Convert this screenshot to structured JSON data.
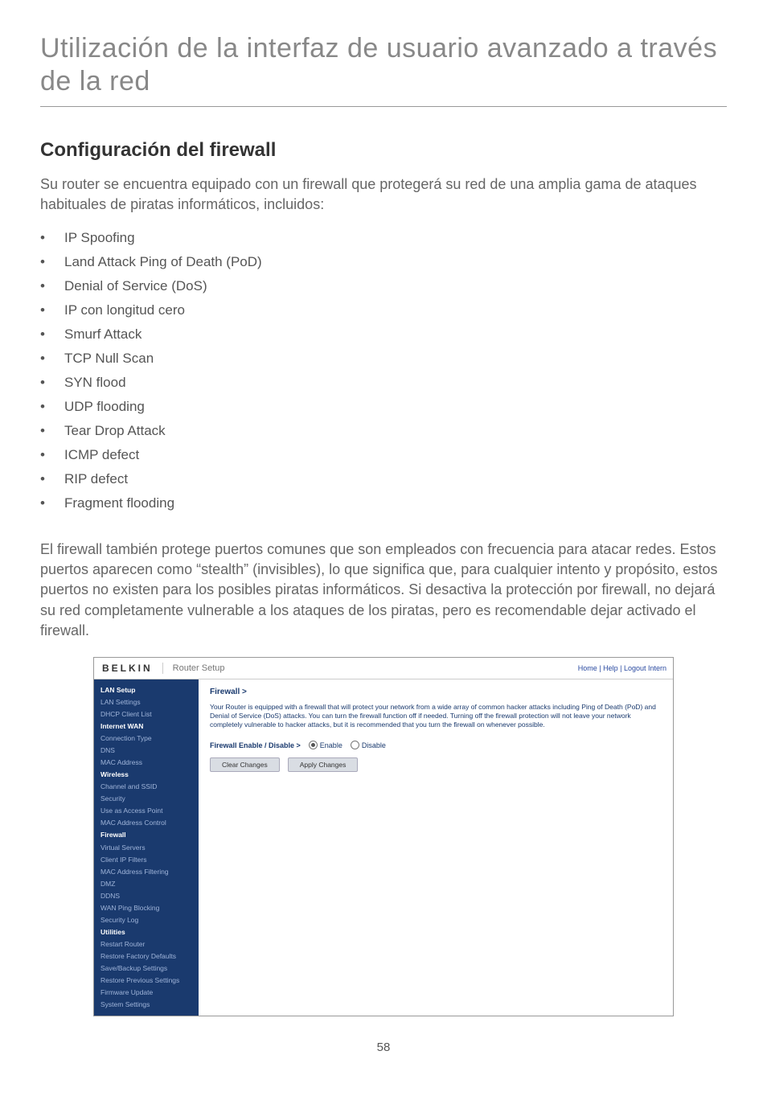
{
  "page_title": "Utilización de la interfaz de usuario avanzado a través de la red",
  "section_title": "Configuración del firewall",
  "intro": "Su router se encuentra equipado con un firewall que protegerá su red de una amplia gama de ataques habituales de piratas informáticos, incluidos:",
  "attacks": [
    "IP Spoofing",
    "Land Attack Ping of Death (PoD)",
    "Denial of Service (DoS)",
    "IP con longitud cero",
    "Smurf Attack",
    "TCP Null Scan",
    "SYN flood",
    "UDP flooding",
    "Tear Drop Attack",
    "ICMP defect",
    "RIP defect",
    "Fragment flooding"
  ],
  "description": "El firewall también protege puertos comunes que son empleados con frecuencia para atacar redes. Estos puertos aparecen como “stealth” (invisibles), lo que significa que, para cualquier intento y propósito, estos puertos no existen para los posibles piratas informáticos. Si desactiva la protección por firewall, no dejará su red completamente vulnerable a los ataques de los piratas, pero es recomendable dejar activado el firewall.",
  "page_number": "58",
  "screenshot": {
    "logo": "BELKIN",
    "header_label": "Router Setup",
    "top_links": "Home | Help | Logout   Intern",
    "sidebar": [
      {
        "label": "LAN Setup",
        "type": "section"
      },
      {
        "label": "LAN Settings",
        "type": "link"
      },
      {
        "label": "DHCP Client List",
        "type": "link"
      },
      {
        "label": "Internet WAN",
        "type": "section"
      },
      {
        "label": "Connection Type",
        "type": "link"
      },
      {
        "label": "DNS",
        "type": "link"
      },
      {
        "label": "MAC Address",
        "type": "link"
      },
      {
        "label": "Wireless",
        "type": "section"
      },
      {
        "label": "Channel and SSID",
        "type": "link"
      },
      {
        "label": "Security",
        "type": "link"
      },
      {
        "label": "Use as Access Point",
        "type": "link"
      },
      {
        "label": "MAC Address Control",
        "type": "link"
      },
      {
        "label": "Firewall",
        "type": "active"
      },
      {
        "label": "Virtual Servers",
        "type": "link"
      },
      {
        "label": "Client IP Filters",
        "type": "link"
      },
      {
        "label": "MAC Address Filtering",
        "type": "link"
      },
      {
        "label": "DMZ",
        "type": "link"
      },
      {
        "label": "DDNS",
        "type": "link"
      },
      {
        "label": "WAN Ping Blocking",
        "type": "link"
      },
      {
        "label": "Security Log",
        "type": "link"
      },
      {
        "label": "Utilities",
        "type": "section"
      },
      {
        "label": "Restart Router",
        "type": "link"
      },
      {
        "label": "Restore Factory Defaults",
        "type": "link"
      },
      {
        "label": "Save/Backup Settings",
        "type": "link"
      },
      {
        "label": "Restore Previous Settings",
        "type": "link"
      },
      {
        "label": "Firmware Update",
        "type": "link"
      },
      {
        "label": "System Settings",
        "type": "link"
      }
    ],
    "main": {
      "crumb": "Firewall >",
      "desc": "Your Router is equipped with a firewall that will protect your network from a wide array of common hacker attacks including Ping of Death (PoD) and Denial of Service (DoS) attacks. You can turn the firewall function off if needed. Turning off the firewall protection will not leave your network completely vulnerable to hacker attacks, but it is recommended that you turn the firewall on whenever possible.",
      "row_label": "Firewall Enable / Disable >",
      "radio_enable": "Enable",
      "radio_disable": "Disable",
      "btn_clear": "Clear Changes",
      "btn_apply": "Apply Changes"
    }
  }
}
